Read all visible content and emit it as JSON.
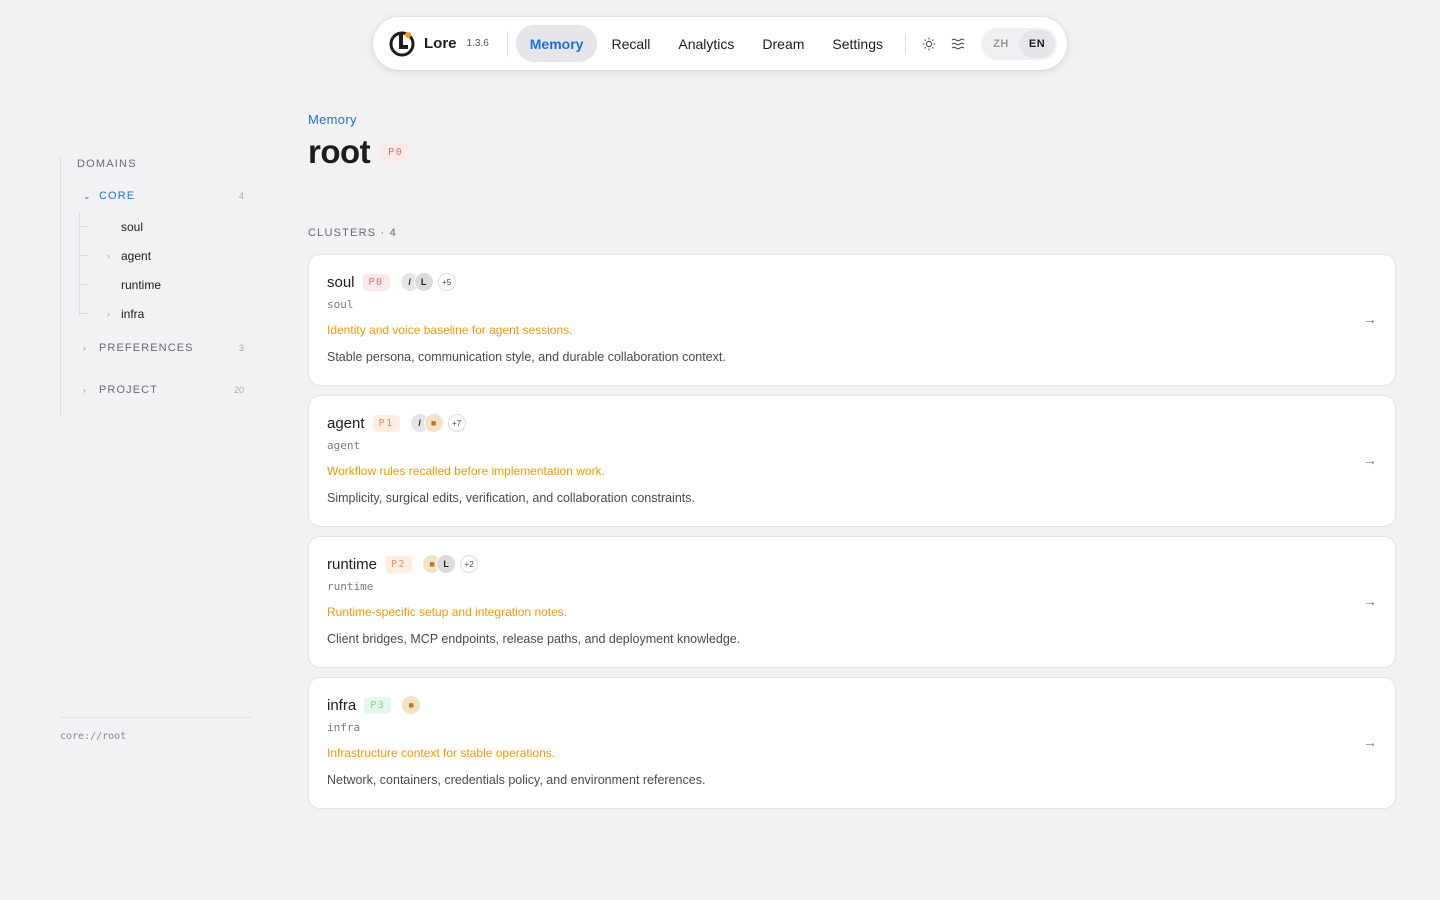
{
  "app": {
    "name": "Lore",
    "version": "1.3.6"
  },
  "nav": {
    "items": [
      {
        "label": "Memory",
        "active": true
      },
      {
        "label": "Recall",
        "active": false
      },
      {
        "label": "Analytics",
        "active": false
      },
      {
        "label": "Dream",
        "active": false
      },
      {
        "label": "Settings",
        "active": false
      }
    ],
    "icons": [
      "sun-icon",
      "waves-icon"
    ],
    "lang": [
      {
        "label": "ZH",
        "active": false
      },
      {
        "label": "EN",
        "active": true
      }
    ]
  },
  "sidebar": {
    "heading": "DOMAINS",
    "domains": [
      {
        "label": "CORE",
        "count": "4",
        "expanded": true,
        "children": [
          {
            "label": "soul",
            "has_children": false
          },
          {
            "label": "agent",
            "has_children": true
          },
          {
            "label": "runtime",
            "has_children": false
          },
          {
            "label": "infra",
            "has_children": true
          }
        ]
      },
      {
        "label": "PREFERENCES",
        "count": "3",
        "expanded": false
      },
      {
        "label": "PROJECT",
        "count": "20",
        "expanded": false
      }
    ],
    "footer_uri": "core://root"
  },
  "main": {
    "breadcrumb": "Memory",
    "title": "root",
    "priority": "P0",
    "clusters_label": "CLUSTERS · 4",
    "clusters": [
      {
        "name": "soul",
        "priority": "P0",
        "key": "soul",
        "summary": "Identity and voice baseline for agent sessions.",
        "description": "Stable persona, communication style, and durable collaboration context.",
        "avatars": [
          "/",
          "L"
        ],
        "more": "+5"
      },
      {
        "name": "agent",
        "priority": "P1",
        "key": "agent",
        "summary": "Workflow rules recalled before implementation work.",
        "description": "Simplicity, surgical edits, verification, and collaboration constraints.",
        "avatars": [
          "/",
          "pixel"
        ],
        "more": "+7"
      },
      {
        "name": "runtime",
        "priority": "P2",
        "key": "runtime",
        "summary": "Runtime-specific setup and integration notes.",
        "description": "Client bridges, MCP endpoints, release paths, and deployment knowledge.",
        "avatars": [
          "pixel",
          "L"
        ],
        "more": "+2"
      },
      {
        "name": "infra",
        "priority": "P3",
        "key": "infra",
        "summary": "Infrastructure context for stable operations.",
        "description": "Network, containers, credentials policy, and environment references.",
        "avatars": [
          "pixel"
        ],
        "more": ""
      }
    ]
  },
  "colors": {
    "accent": "#1a73d9",
    "summary": "#f09a0a",
    "p0": "#e0707c",
    "p1": "#e88c54",
    "p3": "#7fcfa0"
  }
}
